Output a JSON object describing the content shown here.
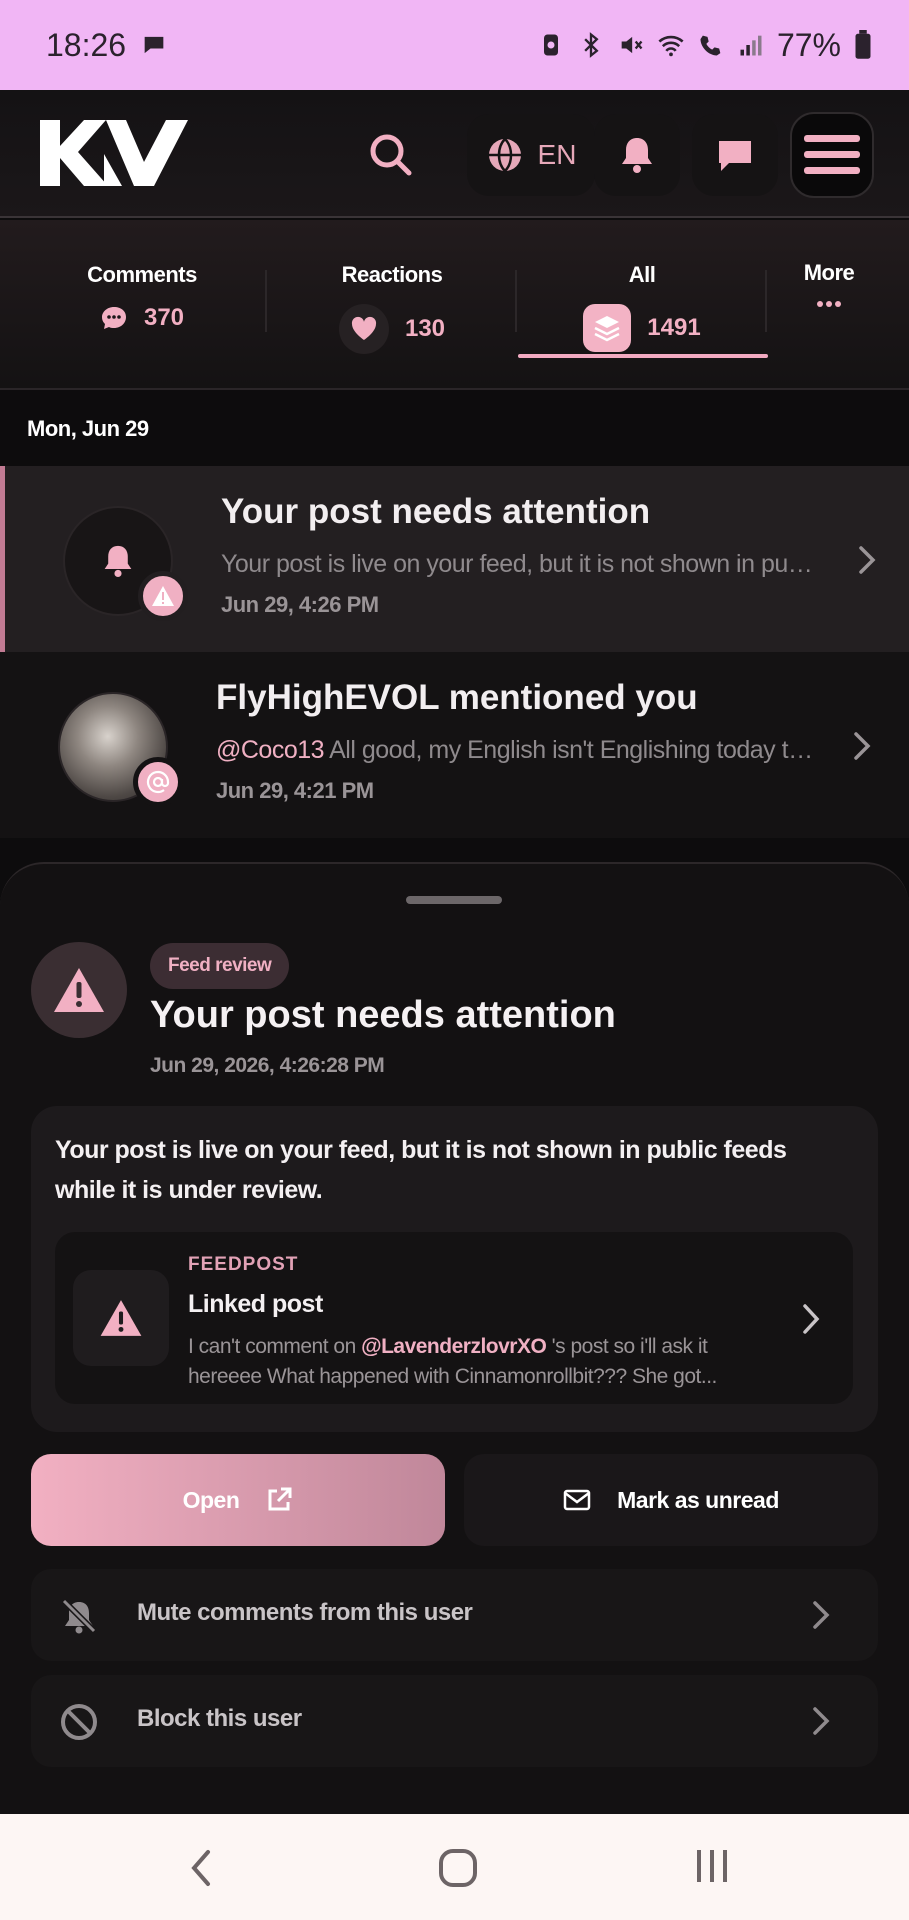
{
  "status_bar": {
    "time": "18:26",
    "battery": "77%"
  },
  "header": {
    "logo_text": "KV",
    "language": "EN"
  },
  "tabs": [
    {
      "label": "Comments",
      "count": "370",
      "icon": "comment-icon"
    },
    {
      "label": "Reactions",
      "count": "130",
      "icon": "heart-icon"
    },
    {
      "label": "All",
      "count": "1491",
      "icon": "layers-icon",
      "active": true
    },
    {
      "label": "More",
      "icon": "more-icon"
    }
  ],
  "date_header": "Mon, Jun 29",
  "notifications": [
    {
      "title": "Your post needs attention",
      "text": "Your post is live on your feed, but it is not shown in public ...",
      "time": "Jun 29, 4:26 PM",
      "icon": "bell-icon",
      "badge_icon": "warning-icon"
    },
    {
      "title": "FlyHighEVOL mentioned you",
      "mention": "@Coco13",
      "text": " All good, my English isn't Englishing today too!! ...",
      "time": "Jun 29, 4:21 PM",
      "badge_icon": "at-icon"
    }
  ],
  "sheet": {
    "badge": "Feed review",
    "title": "Your post needs attention",
    "timestamp": "Jun 29, 2026, 4:26:28 PM",
    "message": "Your post is live on your feed, but it is not shown in public feeds while it is under review.",
    "linked": {
      "kicker": "FEEDPOST",
      "title": "Linked post",
      "excerpt_before": "I can't comment on ",
      "excerpt_mention": "@LavenderzlovrXO",
      "excerpt_after": " 's post so i'll ask it hereeee What happened with Cinnamonrollbit??? She got..."
    },
    "open_label": "Open",
    "unread_label": "Mark as unread",
    "mute_label": "Mute comments from this user",
    "block_label": "Block this user"
  },
  "colors": {
    "accent": "#f0b0c3",
    "status_bar": "#f1b6f5",
    "background": "#0d0c0d"
  }
}
